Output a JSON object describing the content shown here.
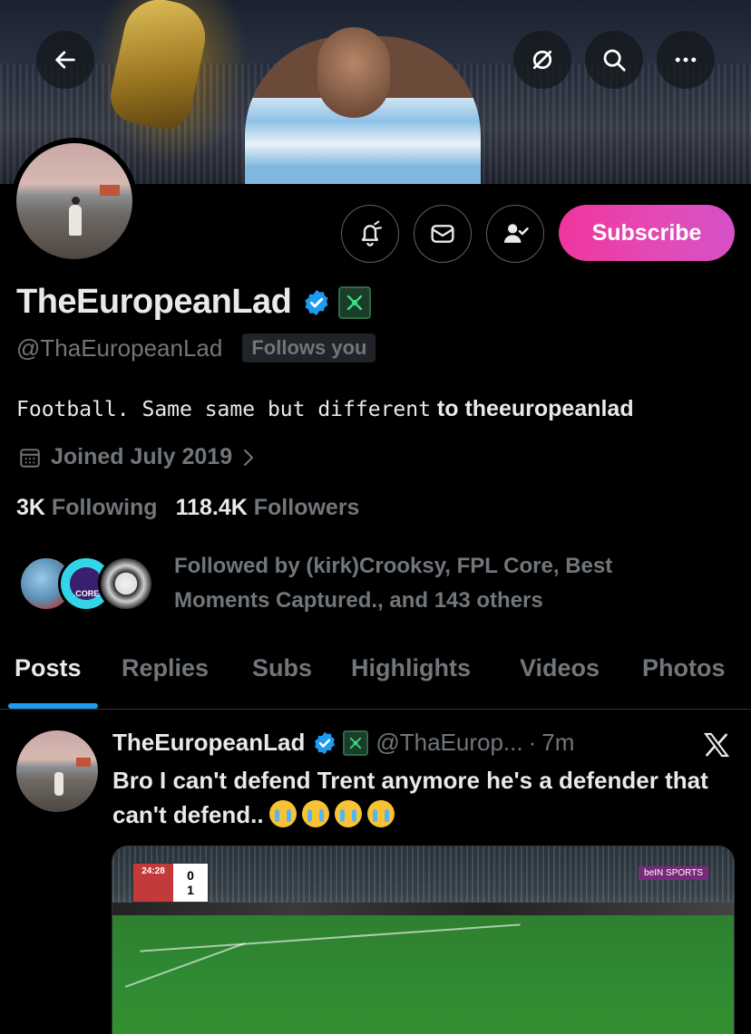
{
  "profile": {
    "display_name": "TheEuropeanLad",
    "handle": "@ThaEuropeanLad",
    "follows_you": "Follows you",
    "bio_text": "Football. Same same but different",
    "bio_link": "to theeuropeanlad",
    "joined": "Joined July 2019",
    "following_count": "3K",
    "following_label": "Following",
    "followers_count": "118.4K",
    "followers_label": "Followers",
    "followed_by": "Followed by (kirk)Crooksy, FPL Core, Best Moments Captured., and 143 others",
    "followed_avatar_2_label": ".CORE"
  },
  "actions": {
    "subscribe_label": "Subscribe"
  },
  "tabs": [
    {
      "label": "Posts",
      "active": true
    },
    {
      "label": "Replies",
      "active": false
    },
    {
      "label": "Subs",
      "active": false
    },
    {
      "label": "Highlights",
      "active": false
    },
    {
      "label": "Videos",
      "active": false
    },
    {
      "label": "Photos",
      "active": false
    }
  ],
  "post": {
    "author": "TheEuropeanLad",
    "handle": "@ThaEurop...",
    "separator": "·",
    "time": "7m",
    "text": "Bro I can't defend Trent anymore he's a defender that can't defend..",
    "emoji_count": 4,
    "media": {
      "score_home": "0",
      "score_away": "1",
      "clock": "24:28",
      "broadcaster": "beIN SPORTS"
    }
  },
  "colors": {
    "accent_blue": "#1d9bf0",
    "subscribe_gradient_start": "#f0359f",
    "subscribe_gradient_end": "#d650c8",
    "muted_text": "#71767b",
    "primary_text": "#e7e9ea",
    "background": "#000000"
  },
  "icons": {
    "back": "arrow-left-icon",
    "ban": "circle-slash-icon",
    "search": "search-icon",
    "more": "more-dots-icon",
    "notify": "bell-plus-icon",
    "message": "envelope-icon",
    "following": "person-check-icon",
    "calendar": "calendar-icon",
    "x_logo": "x-logo-icon"
  }
}
